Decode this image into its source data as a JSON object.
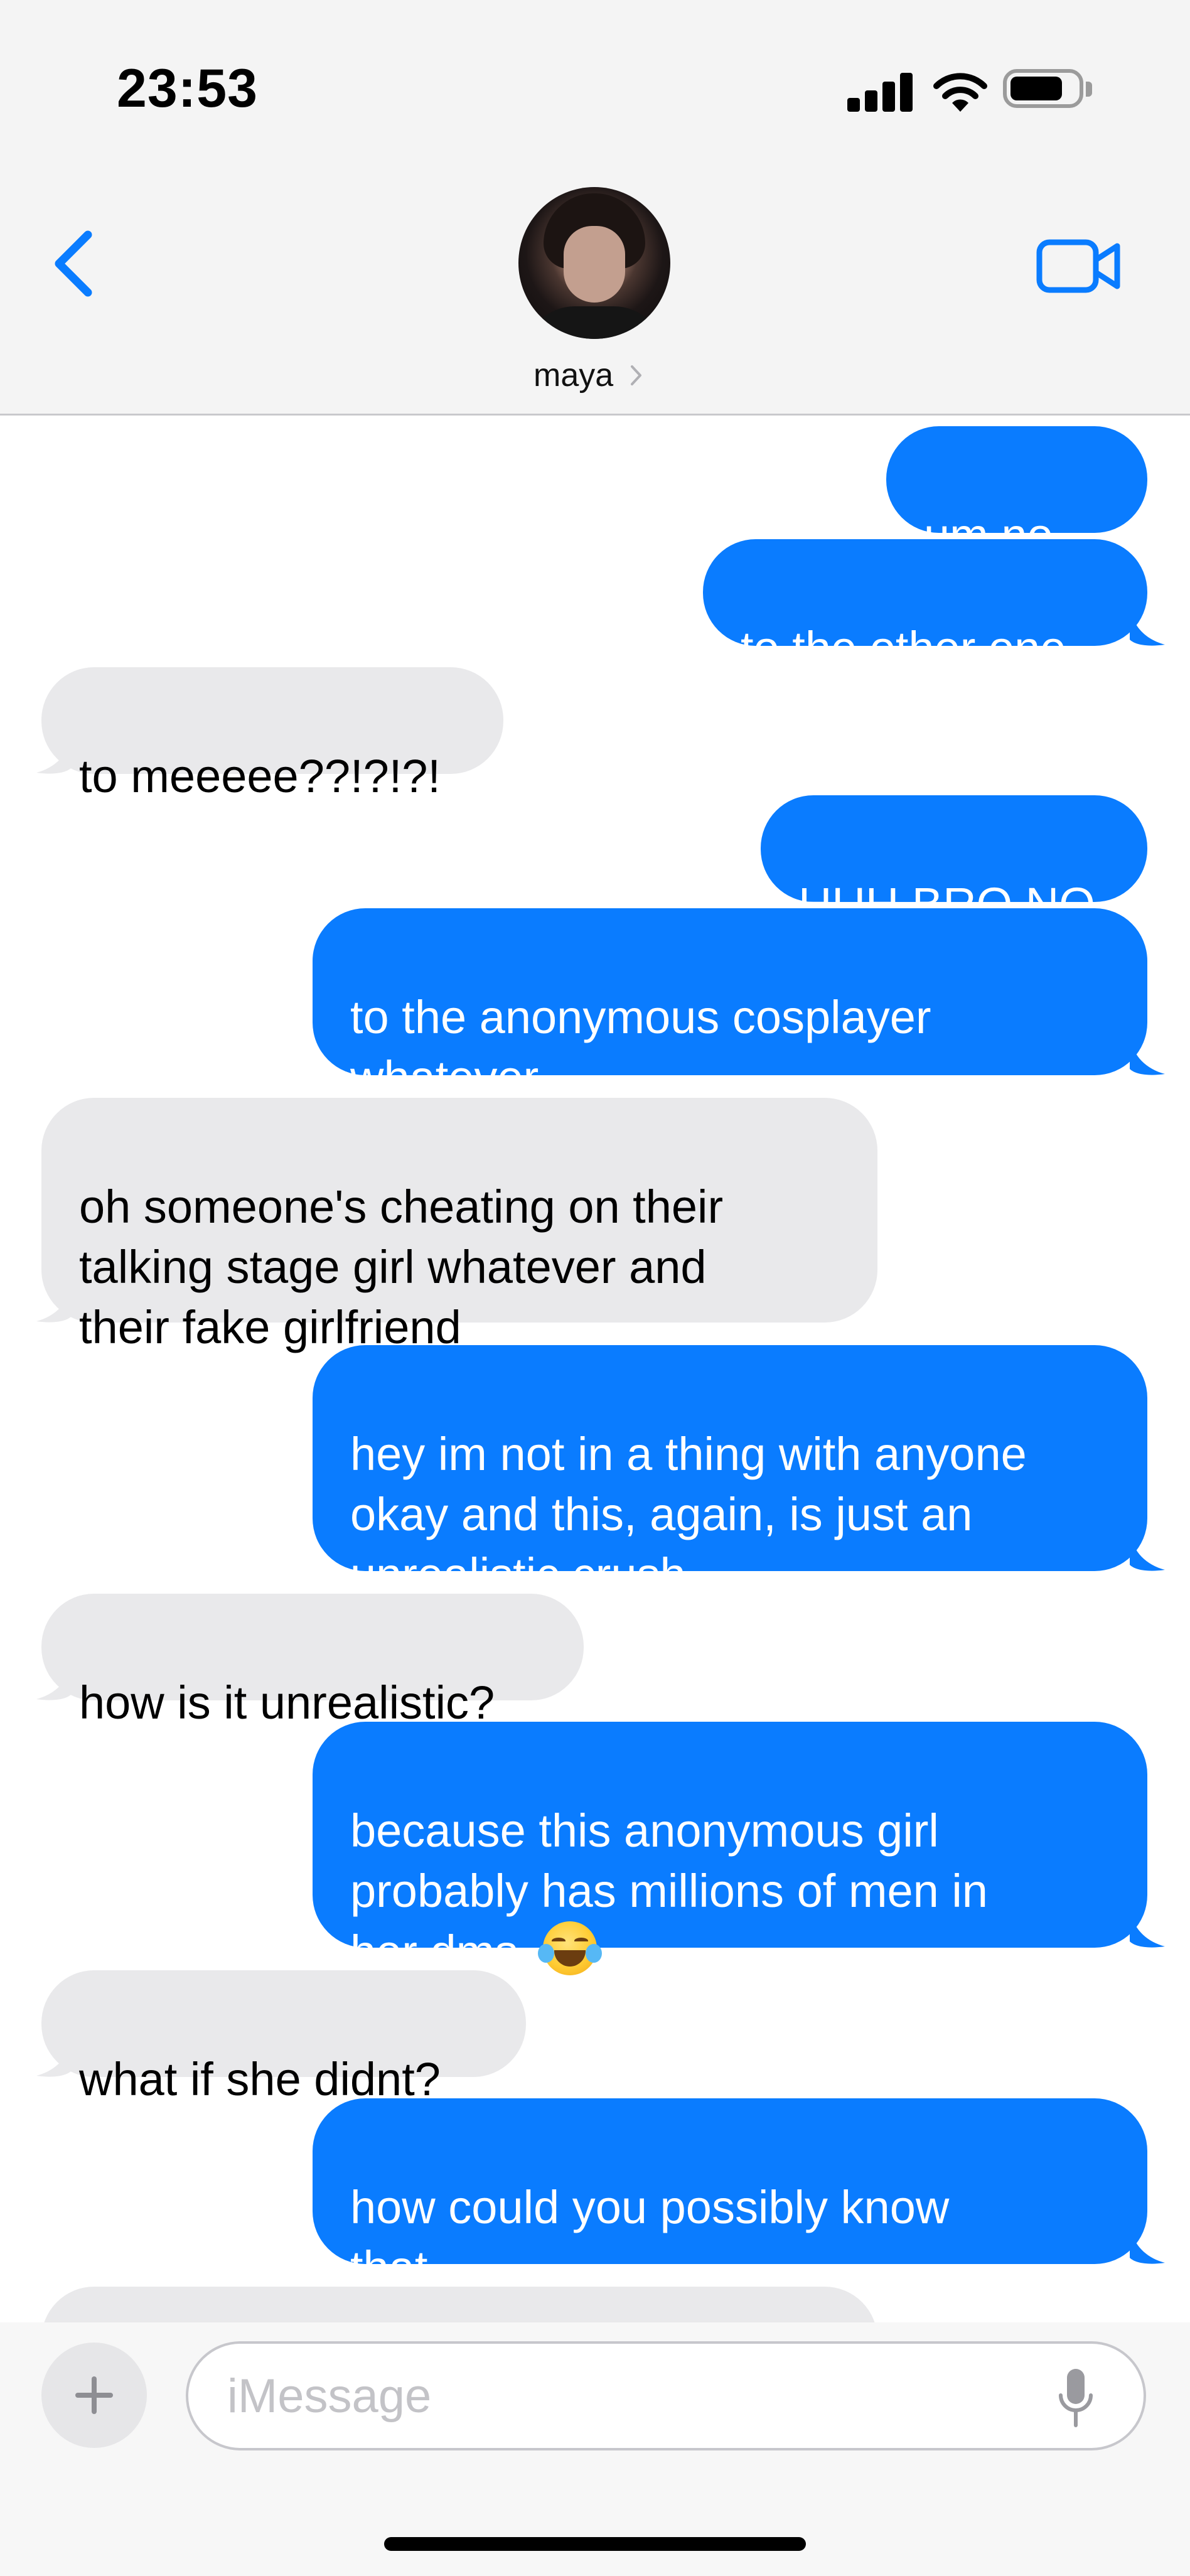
{
  "status_bar": {
    "time": "23:53"
  },
  "header": {
    "contact_name": "maya",
    "back_icon": "chevron-left-icon",
    "video_icon": "video-camera-icon",
    "accent_color": "#0a7cff"
  },
  "messages": [
    {
      "from": "me",
      "text": "um no"
    },
    {
      "from": "me",
      "text": "to the other one"
    },
    {
      "from": "them",
      "text": "to meeeee??!?!?!"
    },
    {
      "from": "me",
      "text": "HUH BRO NO"
    },
    {
      "from": "me",
      "text": "to the anonymous cosplayer\nwhatever"
    },
    {
      "from": "them",
      "text": "oh someone's cheating on their\ntalking stage girl whatever and\ntheir fake girlfriend"
    },
    {
      "from": "me",
      "text": "hey im not in a thing with anyone\nokay and this, again, is just an\nunrealistic crush"
    },
    {
      "from": "them",
      "text": "how is it unrealistic?"
    },
    {
      "from": "me",
      "text": "because this anonymous girl\nprobably has millions of men in\nher dms",
      "emoji": "face-with-tears-of-joy"
    },
    {
      "from": "them",
      "text": "what if she didnt?"
    },
    {
      "from": "me",
      "text": "how could you possibly know\nthat"
    }
  ],
  "composer": {
    "placeholder": "iMessage",
    "plus_icon": "plus-icon",
    "mic_icon": "microphone-icon"
  },
  "colors": {
    "sent_bubble": "#0a7cff",
    "received_bubble": "#e9e9eb"
  }
}
